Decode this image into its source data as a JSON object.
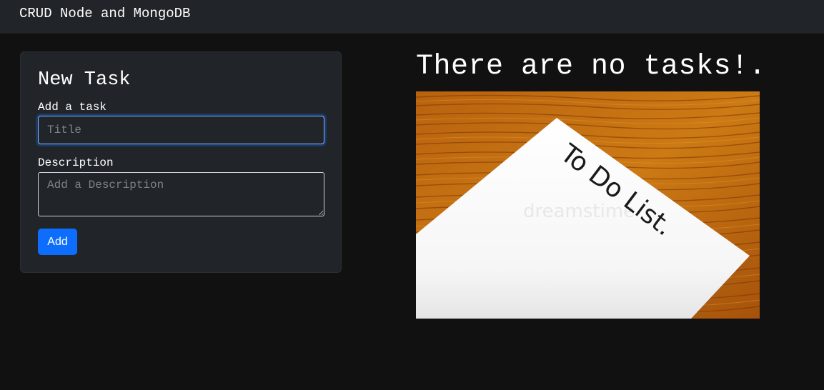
{
  "navbar": {
    "brand": "CRUD Node and MongoDB"
  },
  "form": {
    "title": "New Task",
    "task_label": "Add a task",
    "title_placeholder": "Title",
    "description_label": "Description",
    "description_placeholder": "Add a Description",
    "submit_label": "Add"
  },
  "tasks": {
    "empty_message": "There are no tasks!.",
    "image": {
      "text": "To Do List.",
      "watermark": "dreamstime"
    }
  },
  "colors": {
    "page_bg": "#111112",
    "navbar_bg": "#212529",
    "card_bg": "#212529",
    "primary": "#0d6efd",
    "focus_border": "#86b7fe"
  }
}
